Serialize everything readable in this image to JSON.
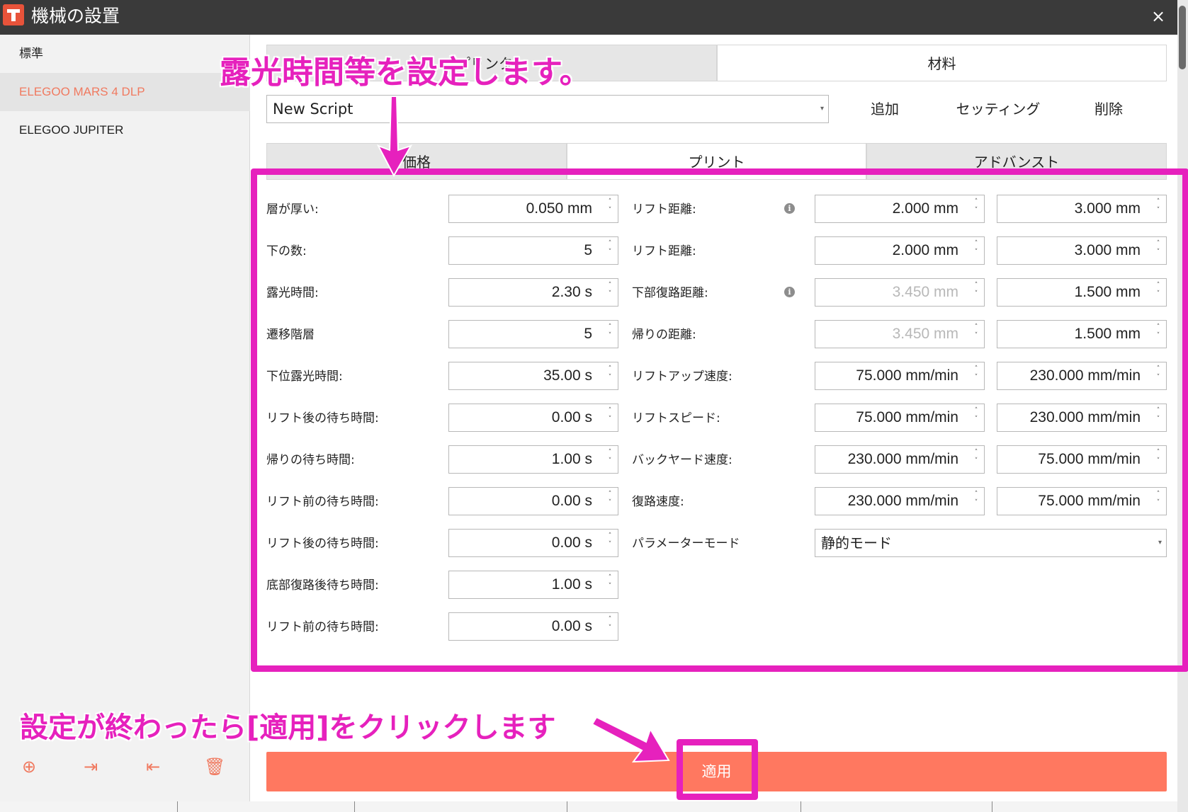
{
  "window": {
    "title": "機械の設置",
    "close_symbol": "×"
  },
  "sidebar": {
    "items": [
      {
        "label": "標準"
      },
      {
        "label": "ELEGOO MARS 4 DLP"
      },
      {
        "label": "ELEGOO JUPITER"
      }
    ]
  },
  "top_tabs": [
    {
      "label": "プリンター"
    },
    {
      "label": "材料"
    }
  ],
  "script": {
    "selected": "New Script"
  },
  "actions": {
    "add": "追加",
    "settings": "セッティング",
    "delete": "削除"
  },
  "sub_tabs": [
    {
      "label": "価格"
    },
    {
      "label": "プリント"
    },
    {
      "label": "アドバンスト"
    }
  ],
  "left_fields": [
    {
      "label": "層が厚い:",
      "value": "0.050 mm"
    },
    {
      "label": "下の数:",
      "value": "5"
    },
    {
      "label": "露光時間:",
      "value": "2.30 s"
    },
    {
      "label": "遷移階層",
      "value": "5"
    },
    {
      "label": "下位露光時間:",
      "value": "35.00 s"
    },
    {
      "label": "リフト後の待ち時間:",
      "value": "0.00 s"
    },
    {
      "label": "帰りの待ち時間:",
      "value": "1.00 s"
    },
    {
      "label": "リフト前の待ち時間:",
      "value": "0.00 s"
    },
    {
      "label": "リフト後の待ち時間:",
      "value": "0.00 s"
    },
    {
      "label": "底部復路後待ち時間:",
      "value": "1.00 s"
    },
    {
      "label": "リフト前の待ち時間:",
      "value": "0.00 s"
    }
  ],
  "right_fields": [
    {
      "label": "リフト距離:",
      "value1": "2.000 mm",
      "value2": "3.000 mm",
      "info": true
    },
    {
      "label": "リフト距離:",
      "value1": "2.000 mm",
      "value2": "3.000 mm"
    },
    {
      "label": "下部復路距離:",
      "value1": "3.450 mm",
      "value2": "1.500 mm",
      "info": true,
      "disabled1": true
    },
    {
      "label": "帰りの距離:",
      "value1": "3.450 mm",
      "value2": "1.500 mm",
      "disabled1": true
    },
    {
      "label": "リフトアップ速度:",
      "value1": "75.000 mm/min",
      "value2": "230.000 mm/min"
    },
    {
      "label": "リフトスピード:",
      "value1": "75.000 mm/min",
      "value2": "230.000 mm/min"
    },
    {
      "label": "バックヤード速度:",
      "value1": "230.000 mm/min",
      "value2": "75.000 mm/min"
    },
    {
      "label": "復路速度:",
      "value1": "230.000 mm/min",
      "value2": "75.000 mm/min"
    }
  ],
  "parameter_mode": {
    "label": "パラメーターモード",
    "selected": "静的モード"
  },
  "apply": {
    "label": "適用"
  },
  "annotations": {
    "top": "露光時間等を設定します。",
    "bottom": "設定が終わったら[適用]をクリックします"
  },
  "colors": {
    "accent": "#ff7860",
    "annotation": "#e621bd",
    "active_sidebar": "#f07a60"
  }
}
